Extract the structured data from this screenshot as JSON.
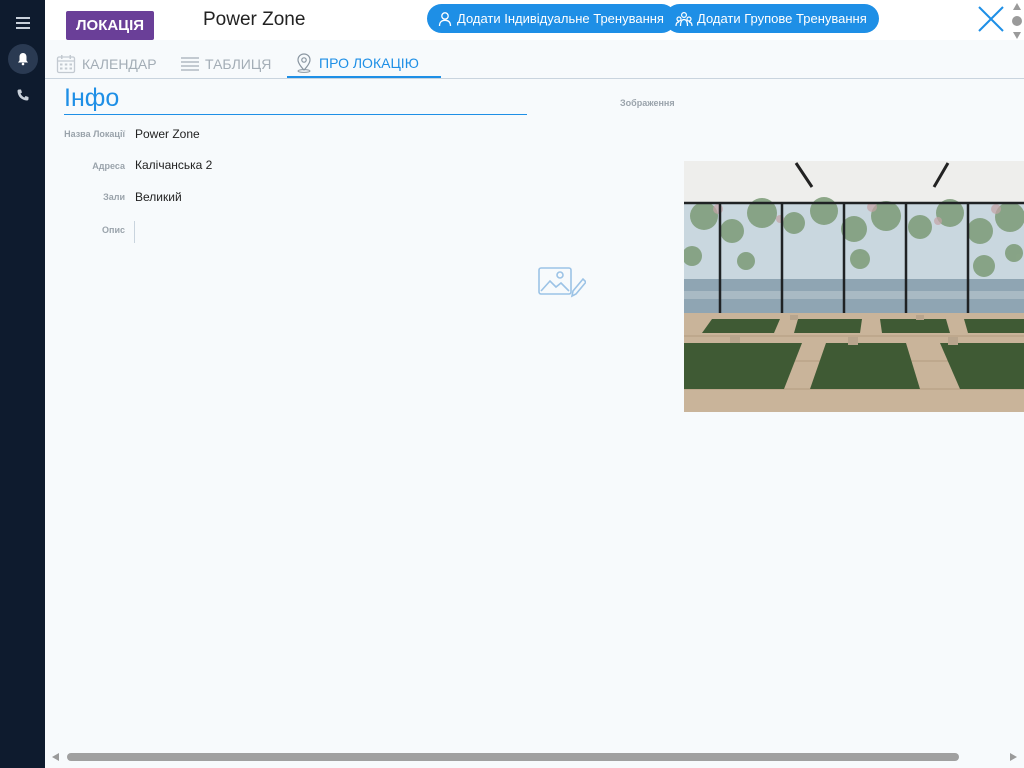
{
  "header": {
    "badge": "ЛОКАЦІЯ",
    "location_title": "Power Zone",
    "add_individual_label": "Додати Індивідуальне Тренування",
    "add_group_label": "Додати Групове Тренування"
  },
  "tabs": [
    {
      "label": "КАЛЕНДАР",
      "icon": "calendar-icon",
      "active": false
    },
    {
      "label": "ТАБЛИЦЯ",
      "icon": "list-icon",
      "active": false
    },
    {
      "label": "ПРО ЛОКАЦІЮ",
      "icon": "map-pin-icon",
      "active": true
    }
  ],
  "info": {
    "title": "Інфо",
    "fields": [
      {
        "label": "Назва Локації",
        "value": "Power Zone"
      },
      {
        "label": "Адреса",
        "value": "Калічанська 2"
      },
      {
        "label": "Зали",
        "value": "Великий"
      },
      {
        "label": "Опис",
        "value": ""
      }
    ]
  },
  "image_section": {
    "label": "Зображення"
  },
  "colors": {
    "accent": "#1e8fe6",
    "badge": "#6a3f98",
    "sidebar": "#0e1b2e"
  }
}
